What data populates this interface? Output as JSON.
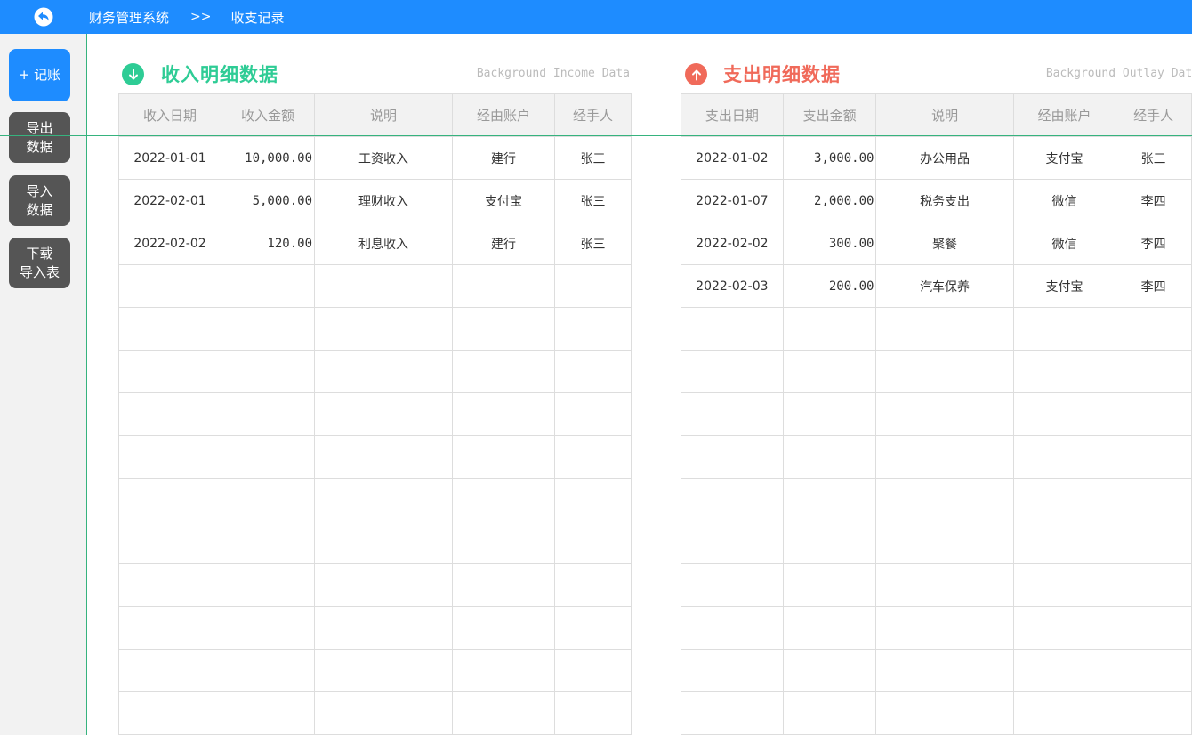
{
  "header": {
    "system_name": "财务管理系统",
    "separator": ">>",
    "page_name": "收支记录"
  },
  "sidebar": {
    "buttons": [
      {
        "label": "+ 记账",
        "kind": "primary"
      },
      {
        "label": "导出\n数据",
        "kind": "dark"
      },
      {
        "label": "导入\n数据",
        "kind": "dark"
      },
      {
        "label": "下载\n导入表",
        "kind": "dark"
      }
    ]
  },
  "income": {
    "title": "收入明细数据",
    "subtitle": "Background Income Data",
    "columns": [
      "收入日期",
      "收入金额",
      "说明",
      "经由账户",
      "经手人"
    ],
    "rows": [
      [
        "2022-01-01",
        "10,000.00",
        "工资收入",
        "建行",
        "张三"
      ],
      [
        "2022-02-01",
        "5,000.00",
        "理财收入",
        "支付宝",
        "张三"
      ],
      [
        "2022-02-02",
        "120.00",
        "利息收入",
        "建行",
        "张三"
      ]
    ]
  },
  "outlay": {
    "title": "支出明细数据",
    "subtitle": "Background Outlay Data",
    "columns": [
      "支出日期",
      "支出金额",
      "说明",
      "经由账户",
      "经手人"
    ],
    "rows": [
      [
        "2022-01-02",
        "3,000.00",
        "办公用品",
        "支付宝",
        "张三"
      ],
      [
        "2022-01-07",
        "2,000.00",
        "税务支出",
        "微信",
        "李四"
      ],
      [
        "2022-02-02",
        "300.00",
        "聚餐",
        "微信",
        "李四"
      ],
      [
        "2022-02-03",
        "200.00",
        "汽车保养",
        "支付宝",
        "李四"
      ]
    ]
  },
  "colors": {
    "primary": "#1e8cff",
    "income_accent": "#2ecc95",
    "outlay_accent": "#f06a5a",
    "sidebar_button": "#555555"
  }
}
